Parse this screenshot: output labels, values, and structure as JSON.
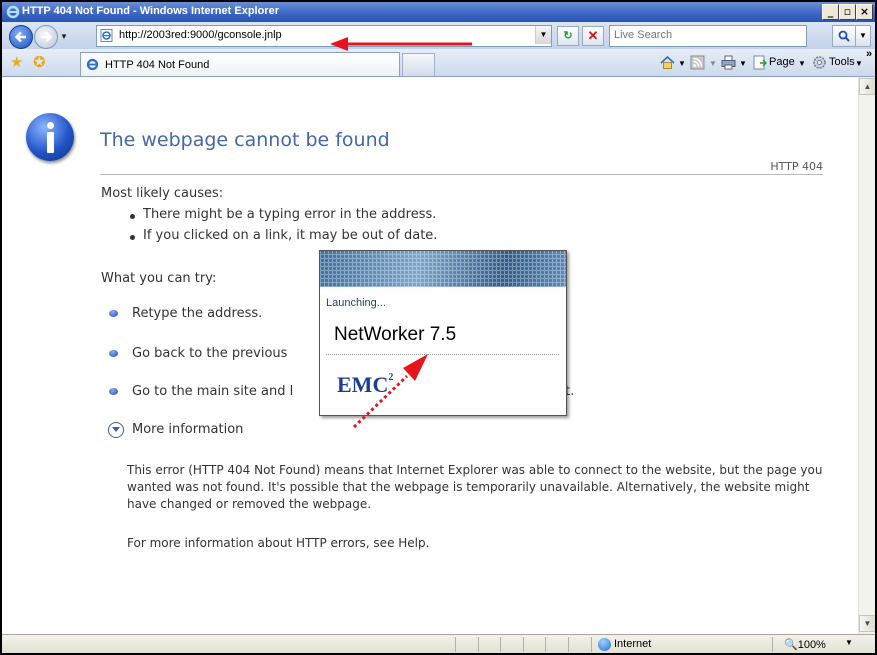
{
  "window": {
    "title": "HTTP 404 Not Found - Windows Internet Explorer",
    "minimize": "_",
    "restore": "▫",
    "close": "×"
  },
  "address_bar": {
    "url": "http://2003red:9000/gconsole.jnlp",
    "search_placeholder": "Live Search"
  },
  "tabs": [
    {
      "label": "HTTP 404 Not Found"
    }
  ],
  "command_bar": {
    "page_label": "Page",
    "tools_label": "Tools",
    "chevron": "»"
  },
  "error_page": {
    "heading": "The webpage cannot be found",
    "code": "HTTP 404",
    "causes_heading": "Most likely causes:",
    "causes": [
      "There might be a typing error in the address.",
      "If you clicked on a link, it may be out of date."
    ],
    "try_heading": "What you can try:",
    "try_items": [
      "Retype the address.",
      "Go back to the previous",
      "Go to the main site and l"
    ],
    "try_item_tail": "t.",
    "more_info": "More information",
    "details": "This error (HTTP 404 Not Found) means that Internet Explorer was able to connect to the website, but the page you wanted was not found. It's possible that the webpage is temporarily unavailable. Alternatively, the website might have changed or removed the webpage.",
    "help_text": "For more information about HTTP errors, see Help."
  },
  "splash": {
    "launching": "Launching...",
    "product": "NetWorker 7.5",
    "logo": "EMC",
    "logo_sup": "2"
  },
  "status_bar": {
    "zone": "Internet",
    "zoom": "100%"
  },
  "colors": {
    "annotation_arrow": "#e8141c",
    "heading_blue": "#4466aa",
    "titlebar": "#3a64c4"
  }
}
